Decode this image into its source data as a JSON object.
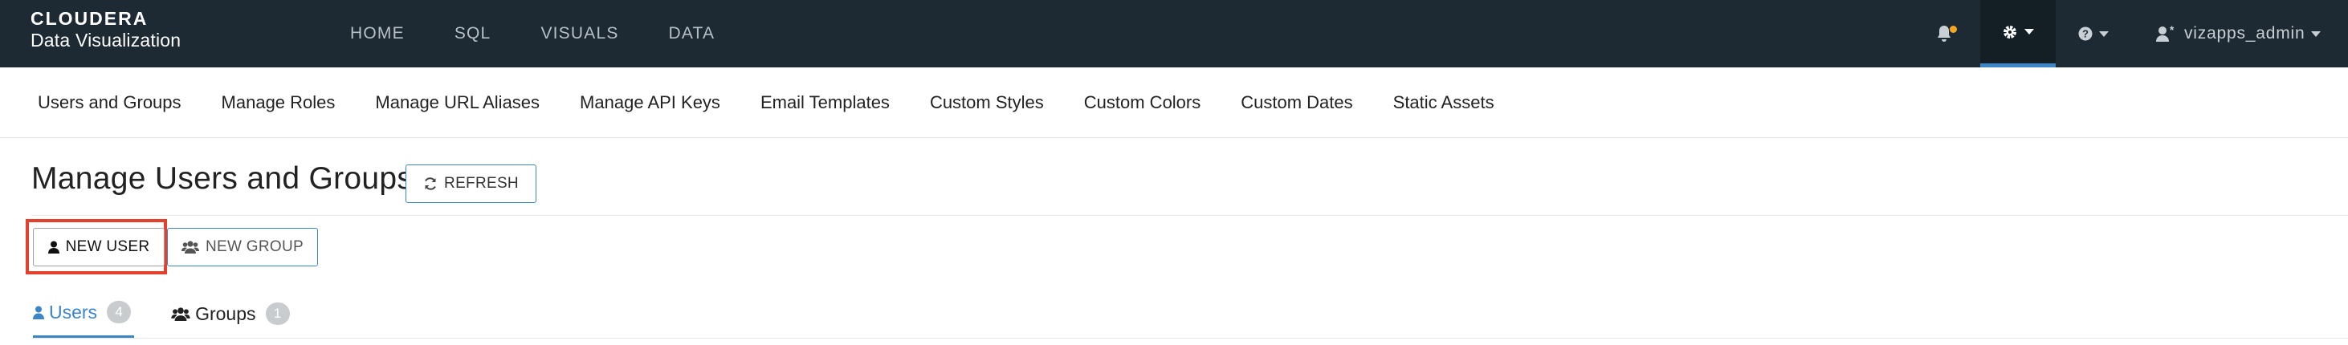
{
  "brand": {
    "name_top": "CLOUDERA",
    "name_sub": "Data Visualization"
  },
  "nav": {
    "items": [
      {
        "label": "HOME"
      },
      {
        "label": "SQL"
      },
      {
        "label": "VISUALS"
      },
      {
        "label": "DATA"
      }
    ]
  },
  "topbar": {
    "username": "vizapps_admin",
    "icons": [
      "bell-icon",
      "gear-icon",
      "help-icon",
      "user-admin-icon"
    ],
    "accent_color": "#3c86c8",
    "notification_color": "#f5a623"
  },
  "subnav": {
    "items": [
      {
        "label": "Users and Groups"
      },
      {
        "label": "Manage Roles"
      },
      {
        "label": "Manage URL Aliases"
      },
      {
        "label": "Manage API Keys"
      },
      {
        "label": "Email Templates"
      },
      {
        "label": "Custom Styles"
      },
      {
        "label": "Custom Colors"
      },
      {
        "label": "Custom Dates"
      },
      {
        "label": "Static Assets"
      }
    ]
  },
  "page": {
    "title": "Manage Users and Groups",
    "refresh_label": "REFRESH",
    "new_user_label": "NEW USER",
    "new_group_label": "NEW GROUP",
    "highlight_color": "#e4402c"
  },
  "tabs": [
    {
      "label": "Users",
      "count": "4",
      "active": true
    },
    {
      "label": "Groups",
      "count": "1",
      "active": false
    }
  ]
}
